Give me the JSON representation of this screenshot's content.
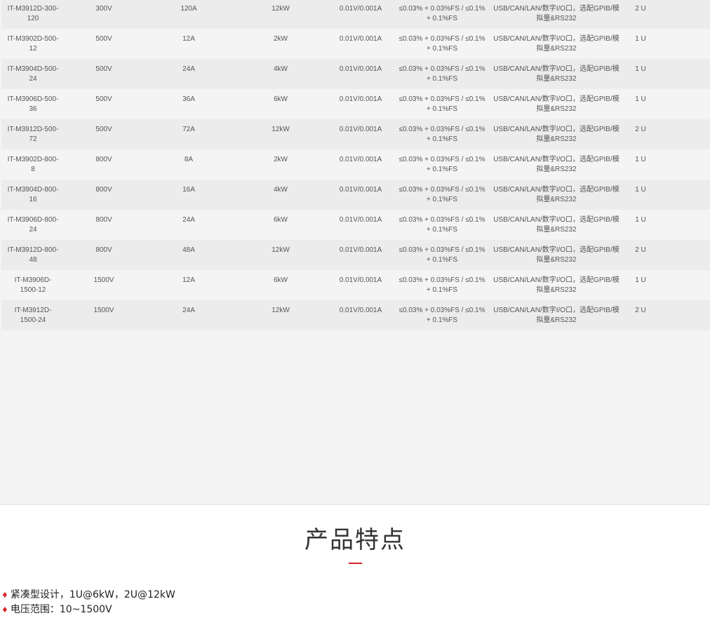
{
  "spec_table": {
    "rows": [
      {
        "model": "IT-M3912D-300-120",
        "voltage": "300V",
        "current": "120A",
        "power": "12kW",
        "resolution": "0.01V/0.001A",
        "accuracy": "≤0.03% + 0.03%FS / ≤0.1% + 0.1%FS",
        "interfaces": "USB/CAN/LAN/数字I/O口，选配GPIB/模拟量&RS232",
        "size": "2 U"
      },
      {
        "model": "IT-M3902D-500-12",
        "voltage": "500V",
        "current": "12A",
        "power": "2kW",
        "resolution": "0.01V/0.001A",
        "accuracy": "≤0.03% + 0.03%FS / ≤0.1% + 0.1%FS",
        "interfaces": "USB/CAN/LAN/数字I/O口，选配GPIB/模拟量&RS232",
        "size": "1 U"
      },
      {
        "model": "IT-M3904D-500-24",
        "voltage": "500V",
        "current": "24A",
        "power": "4kW",
        "resolution": "0.01V/0.001A",
        "accuracy": "≤0.03% + 0.03%FS / ≤0.1% + 0.1%FS",
        "interfaces": "USB/CAN/LAN/数字I/O口，选配GPIB/模拟量&RS232",
        "size": "1 U"
      },
      {
        "model": "IT-M3906D-500-36",
        "voltage": "500V",
        "current": "36A",
        "power": "6kW",
        "resolution": "0.01V/0.001A",
        "accuracy": "≤0.03% + 0.03%FS / ≤0.1% + 0.1%FS",
        "interfaces": "USB/CAN/LAN/数字I/O口，选配GPIB/模拟量&RS232",
        "size": "1 U"
      },
      {
        "model": "IT-M3912D-500-72",
        "voltage": "500V",
        "current": "72A",
        "power": "12kW",
        "resolution": "0.01V/0.001A",
        "accuracy": "≤0.03% + 0.03%FS / ≤0.1% + 0.1%FS",
        "interfaces": "USB/CAN/LAN/数字I/O口，选配GPIB/模拟量&RS232",
        "size": "2 U"
      },
      {
        "model": "IT-M3902D-800-8",
        "voltage": "800V",
        "current": "8A",
        "power": "2kW",
        "resolution": "0.01V/0.001A",
        "accuracy": "≤0.03% + 0.03%FS / ≤0.1% + 0.1%FS",
        "interfaces": "USB/CAN/LAN/数字I/O口，选配GPIB/模拟量&RS232",
        "size": "1 U"
      },
      {
        "model": "IT-M3904D-800-16",
        "voltage": "800V",
        "current": "16A",
        "power": "4kW",
        "resolution": "0.01V/0.001A",
        "accuracy": "≤0.03% + 0.03%FS / ≤0.1% + 0.1%FS",
        "interfaces": "USB/CAN/LAN/数字I/O口，选配GPIB/模拟量&RS232",
        "size": "1 U"
      },
      {
        "model": "IT-M3906D-800-24",
        "voltage": "800V",
        "current": "24A",
        "power": "6kW",
        "resolution": "0.01V/0.001A",
        "accuracy": "≤0.03% + 0.03%FS / ≤0.1% + 0.1%FS",
        "interfaces": "USB/CAN/LAN/数字I/O口，选配GPIB/模拟量&RS232",
        "size": "1 U"
      },
      {
        "model": "IT-M3912D-800-48",
        "voltage": "800V",
        "current": "48A",
        "power": "12kW",
        "resolution": "0.01V/0.001A",
        "accuracy": "≤0.03% + 0.03%FS / ≤0.1% + 0.1%FS",
        "interfaces": "USB/CAN/LAN/数字I/O口，选配GPIB/模拟量&RS232",
        "size": "2 U"
      },
      {
        "model": "IT-M3906D-1500-12",
        "voltage": "1500V",
        "current": "12A",
        "power": "6kW",
        "resolution": "0.01V/0.001A",
        "accuracy": "≤0.03% + 0.03%FS / ≤0.1% + 0.1%FS",
        "interfaces": "USB/CAN/LAN/数字I/O口，选配GPIB/模拟量&RS232",
        "size": "1 U"
      },
      {
        "model": "IT-M3912D-1500-24",
        "voltage": "1500V",
        "current": "24A",
        "power": "12kW",
        "resolution": "0.01V/0.001A",
        "accuracy": "≤0.03% + 0.03%FS / ≤0.1% + 0.1%FS",
        "interfaces": "USB/CAN/LAN/数字I/O口，选配GPIB/模拟量&RS232",
        "size": "2 U"
      }
    ]
  },
  "features_section": {
    "title": "产品特点",
    "bullet_icon": "diamond-bullet-icon",
    "accent_color": "#d8232a",
    "items": [
      "紧凑型设计，1U@6kW，2U@12kW",
      "电压范围：10~1500V"
    ]
  }
}
